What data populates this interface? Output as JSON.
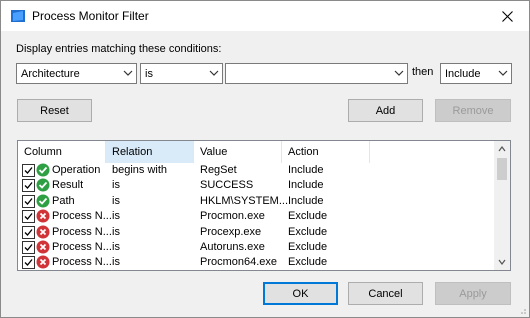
{
  "window": {
    "title": "Process Monitor Filter"
  },
  "conditions_label": "Display entries matching these conditions:",
  "filter_row": {
    "column_value": "Architecture",
    "relation_value": "is",
    "value_text": "",
    "then_label": "then",
    "action_value": "Include"
  },
  "buttons": {
    "reset": "Reset",
    "add": "Add",
    "remove": "Remove",
    "ok": "OK",
    "cancel": "Cancel",
    "apply": "Apply"
  },
  "columns": [
    "Column",
    "Relation",
    "Value",
    "Action"
  ],
  "rows": [
    {
      "column": "Operation",
      "relation": "begins with",
      "value": "RegSet",
      "action": "Include",
      "type": "include",
      "checked": true
    },
    {
      "column": "Result",
      "relation": "is",
      "value": "SUCCESS",
      "action": "Include",
      "type": "include",
      "checked": true
    },
    {
      "column": "Path",
      "relation": "is",
      "value": "HKLM\\SYSTEM...",
      "action": "Include",
      "type": "include",
      "checked": true
    },
    {
      "column": "Process N...",
      "relation": "is",
      "value": "Procmon.exe",
      "action": "Exclude",
      "type": "exclude",
      "checked": true
    },
    {
      "column": "Process N...",
      "relation": "is",
      "value": "Procexp.exe",
      "action": "Exclude",
      "type": "exclude",
      "checked": true
    },
    {
      "column": "Process N...",
      "relation": "is",
      "value": "Autoruns.exe",
      "action": "Exclude",
      "type": "exclude",
      "checked": true
    },
    {
      "column": "Process N...",
      "relation": "is",
      "value": "Procmon64.exe",
      "action": "Exclude",
      "type": "exclude",
      "checked": true
    }
  ],
  "colors": {
    "include": "#2ea043",
    "exclude": "#d13438",
    "accent": "#0078d7",
    "header_active": "#d9ebf9"
  },
  "icons": {
    "window": "process-monitor-icon",
    "include": "checkmark-circle-icon",
    "exclude": "x-circle-icon",
    "close": "close-icon",
    "dropdown": "chevron-down-icon"
  }
}
